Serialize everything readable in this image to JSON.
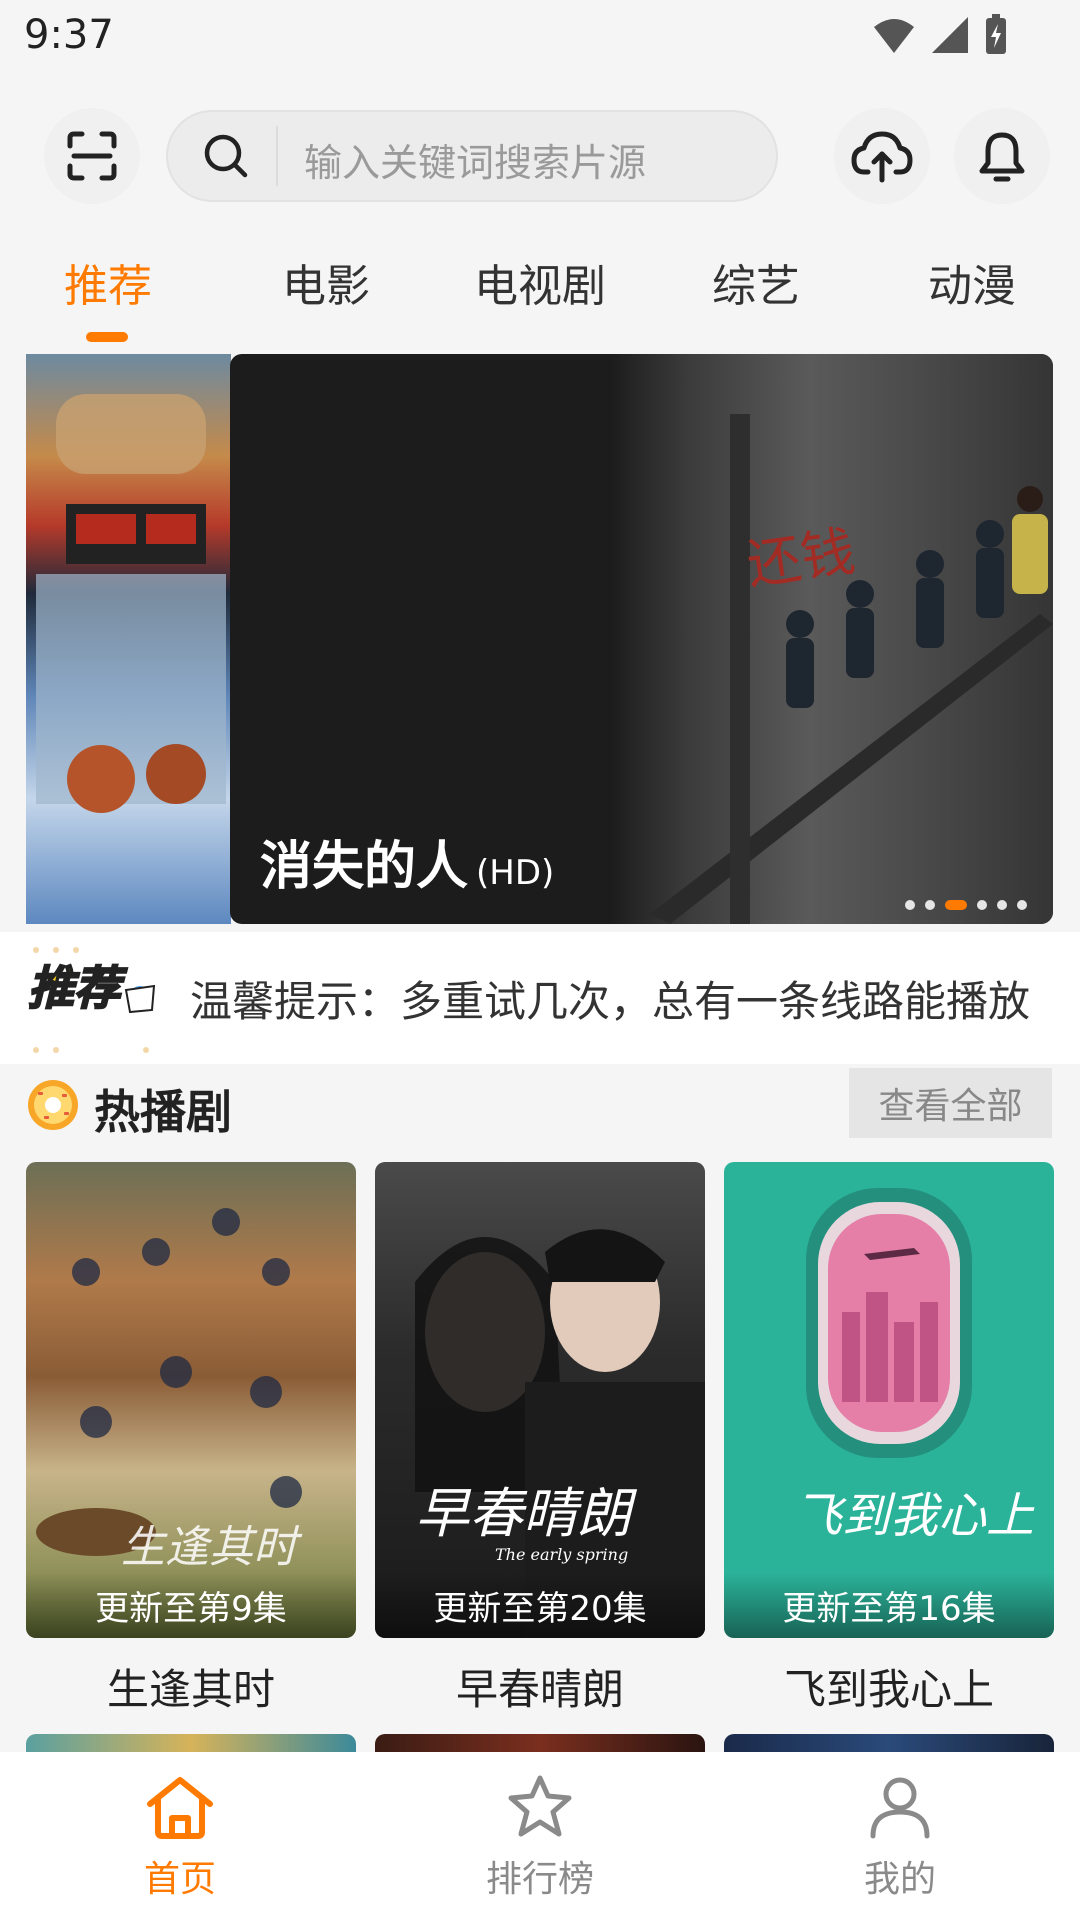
{
  "status_bar": {
    "time": "9:37"
  },
  "search": {
    "placeholder": "输入关键词搜索片源"
  },
  "tabs": [
    {
      "label": "推荐",
      "active": true
    },
    {
      "label": "电影",
      "active": false
    },
    {
      "label": "电视剧",
      "active": false
    },
    {
      "label": "综艺",
      "active": false
    },
    {
      "label": "动漫",
      "active": false
    }
  ],
  "banner": {
    "title": "消失的人",
    "quality": "(HD)",
    "page_count": 6,
    "active_page": 3
  },
  "notice": {
    "badge": "推荐",
    "text": "温馨提示：多重试几次，总有一条线路能播放"
  },
  "hot_section": {
    "title": "热播剧",
    "view_all": "查看全部"
  },
  "hot_items": [
    {
      "title": "生逢其时",
      "update": "更新至第9集",
      "poster_text": "生逢其时"
    },
    {
      "title": "早春晴朗",
      "update": "更新至第20集",
      "poster_text": "早春晴朗",
      "poster_sub": "The early spring"
    },
    {
      "title": "飞到我心上",
      "update": "更新至第16集",
      "poster_text": "飞到我心上"
    }
  ],
  "bottom_nav": [
    {
      "label": "首页",
      "active": true
    },
    {
      "label": "排行榜",
      "active": false
    },
    {
      "label": "我的",
      "active": false
    }
  ],
  "colors": {
    "accent": "#ff7a00",
    "background": "#f5f5f5"
  }
}
